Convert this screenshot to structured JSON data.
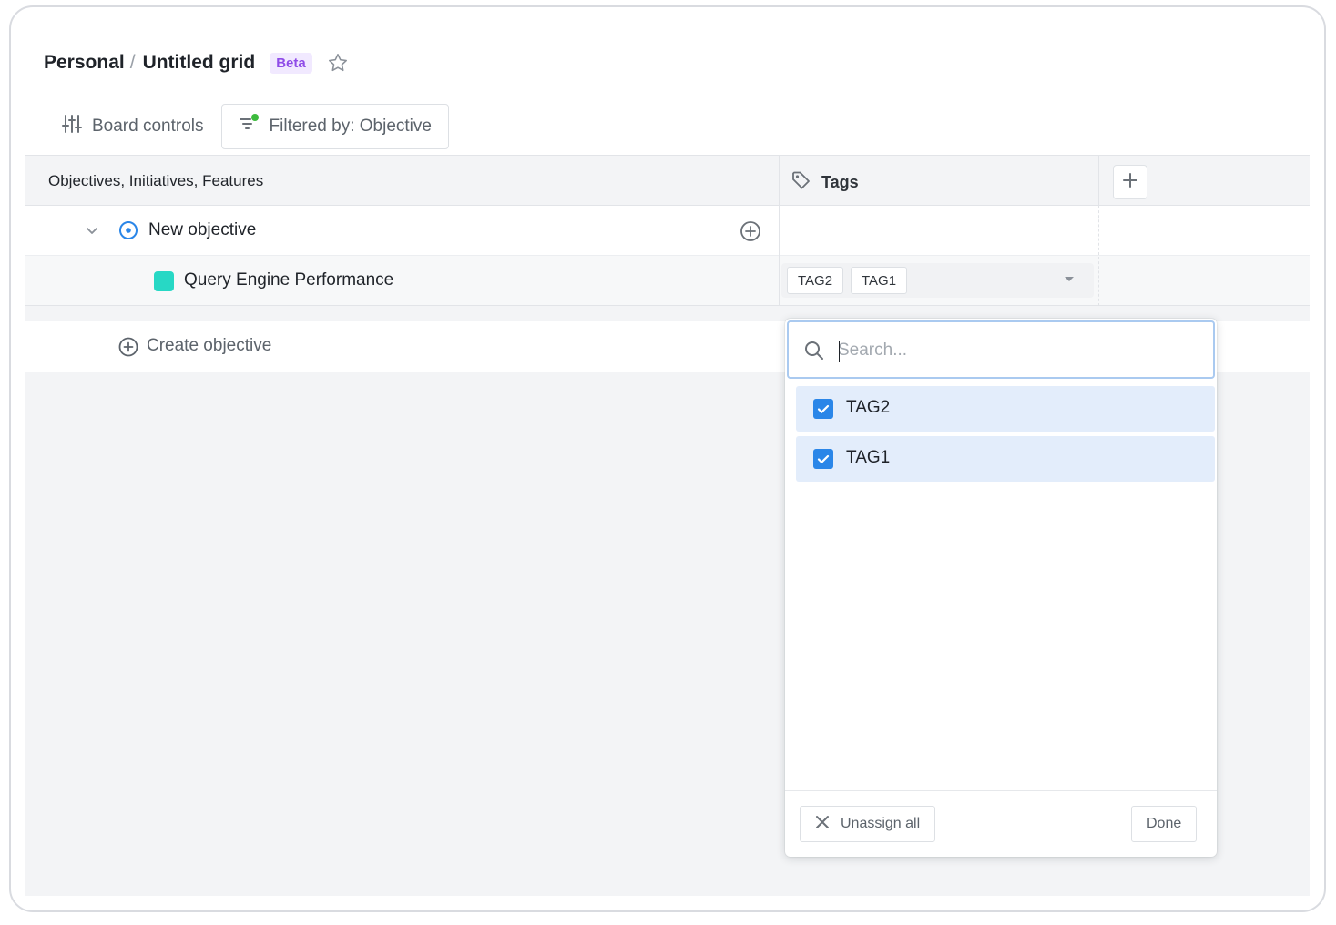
{
  "header": {
    "breadcrumb_parent": "Personal",
    "separator": "/",
    "title": "Untitled grid",
    "badge": "Beta",
    "star_icon": "star-outline-icon"
  },
  "toolbar": {
    "board_controls": "Board controls",
    "filter": "Filtered by: Objective"
  },
  "grid": {
    "column_main": "Objectives, Initiatives, Features",
    "column_tags": "Tags",
    "rows": [
      {
        "type": "objective",
        "label": "New objective",
        "expanded": true
      },
      {
        "type": "feature",
        "label": "Query Engine Performance",
        "color": "#27d8c5",
        "tags": [
          "TAG2",
          "TAG1"
        ]
      }
    ],
    "create_label": "Create objective"
  },
  "tag_dropdown": {
    "search_placeholder": "Search...",
    "search_value": "",
    "options": [
      {
        "label": "TAG2",
        "checked": true
      },
      {
        "label": "TAG1",
        "checked": true
      }
    ],
    "unassign_label": "Unassign all",
    "done_label": "Done"
  },
  "colors": {
    "accent": "#2a86e8",
    "beta_text": "#8f4ce8",
    "beta_bg": "#f1e9ff",
    "filter_dot": "#3dbb3d",
    "selected_option_bg": "#e3edfb"
  }
}
